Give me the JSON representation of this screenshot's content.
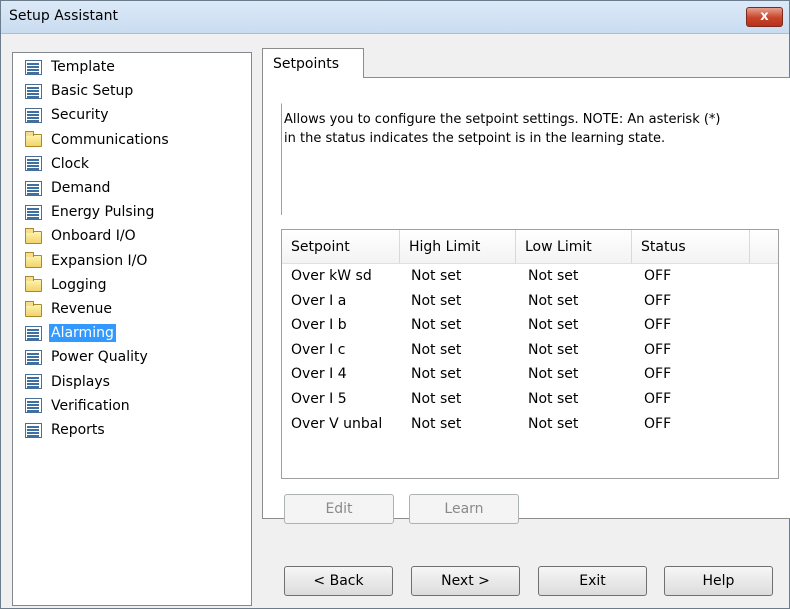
{
  "window": {
    "title": "Setup Assistant",
    "close_label": "x"
  },
  "tree": {
    "items": [
      {
        "label": "Template",
        "icon": "document-icon"
      },
      {
        "label": "Basic Setup",
        "icon": "document-icon"
      },
      {
        "label": "Security",
        "icon": "document-icon"
      },
      {
        "label": "Communications",
        "icon": "folder-icon"
      },
      {
        "label": "Clock",
        "icon": "document-icon"
      },
      {
        "label": "Demand",
        "icon": "document-icon"
      },
      {
        "label": "Energy Pulsing",
        "icon": "document-icon"
      },
      {
        "label": "Onboard I/O",
        "icon": "folder-icon"
      },
      {
        "label": "Expansion I/O",
        "icon": "folder-icon"
      },
      {
        "label": "Logging",
        "icon": "folder-icon"
      },
      {
        "label": "Revenue",
        "icon": "folder-icon"
      },
      {
        "label": "Alarming",
        "icon": "document-icon",
        "selected": true
      },
      {
        "label": "Power Quality",
        "icon": "document-icon"
      },
      {
        "label": "Displays",
        "icon": "document-icon"
      },
      {
        "label": "Verification",
        "icon": "document-icon"
      },
      {
        "label": "Reports",
        "icon": "document-icon"
      }
    ]
  },
  "tabs": [
    {
      "label": "Setpoints"
    }
  ],
  "description": {
    "line1": "Allows you to configure the setpoint settings. NOTE: An asterisk (*)",
    "line2": "in the status indicates the setpoint is in the learning state."
  },
  "table": {
    "columns": [
      "Setpoint",
      "High Limit",
      "Low Limit",
      "Status"
    ],
    "rows": [
      [
        "Over kW sd",
        "Not set",
        "Not set",
        "OFF"
      ],
      [
        "Over I a",
        "Not set",
        "Not set",
        "OFF"
      ],
      [
        "Over I b",
        "Not set",
        "Not set",
        "OFF"
      ],
      [
        "Over I c",
        "Not set",
        "Not set",
        "OFF"
      ],
      [
        "Over I 4",
        "Not set",
        "Not set",
        "OFF"
      ],
      [
        "Over I 5",
        "Not set",
        "Not set",
        "OFF"
      ],
      [
        "Over V unbal",
        "Not set",
        "Not set",
        "OFF"
      ]
    ]
  },
  "actions": {
    "edit": "Edit",
    "learn": "Learn"
  },
  "footer": {
    "back": "< Back",
    "next": "Next >",
    "exit": "Exit",
    "help": "Help"
  },
  "colors": {
    "selection": "#3399ff",
    "close": "#c7432a"
  }
}
